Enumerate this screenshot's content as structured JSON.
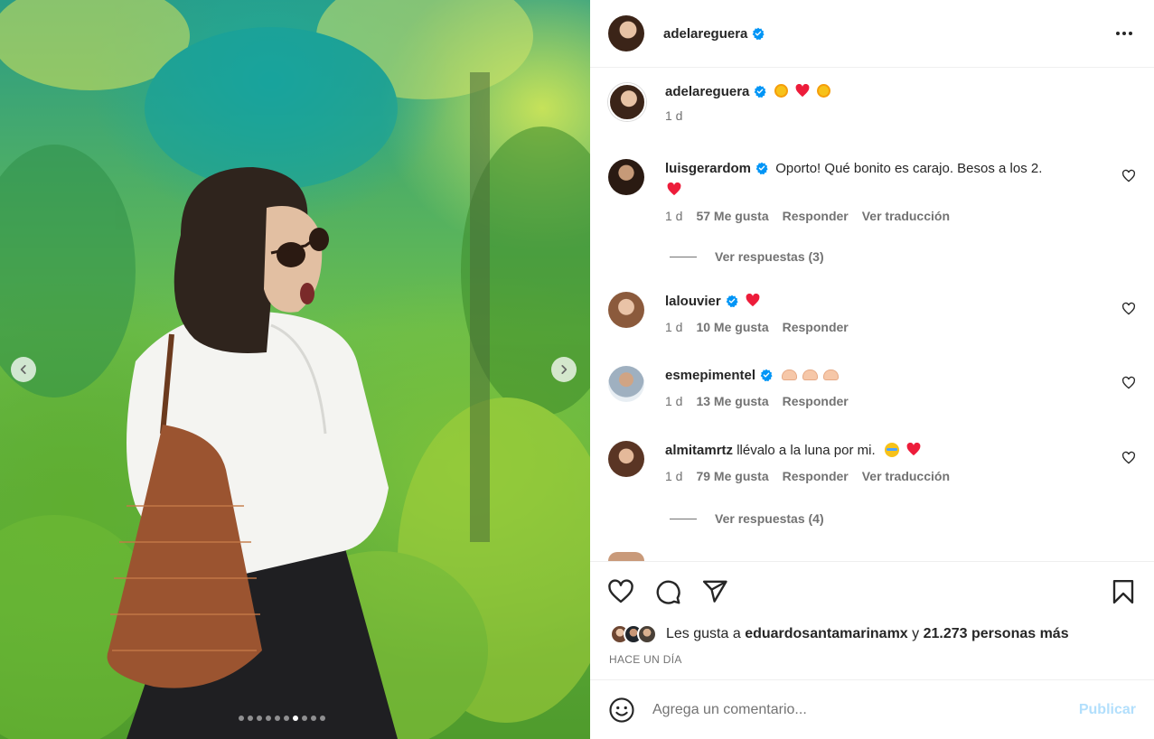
{
  "post": {
    "image_alt": "Mujer con gafas de sol, camisa blanca y bolso tejido en un bosque",
    "carousel": {
      "total": 10,
      "active": 7
    },
    "username": "adelareguera",
    "more_icon": "more-horizontal-icon"
  },
  "caption": {
    "username": "adelareguera",
    "emojis": [
      "sun",
      "red-heart",
      "sun"
    ],
    "time": "1 d"
  },
  "comments": [
    {
      "username": "luisgerardom",
      "verified": true,
      "text": "Oporto! Qué bonito es carajo. Besos a los 2.",
      "emojis": [
        "red-heart"
      ],
      "time": "1 d",
      "likes": "57 Me gusta",
      "reply": "Responder",
      "translate": "Ver traducción",
      "replies_label": "Ver respuestas (3)"
    },
    {
      "username": "lalouvier",
      "verified": true,
      "text": "",
      "emojis": [
        "red-heart"
      ],
      "time": "1 d",
      "likes": "10 Me gusta",
      "reply": "Responder"
    },
    {
      "username": "esmepimentel",
      "verified": true,
      "text": "",
      "emojis": [
        "heart-hands",
        "heart-hands",
        "heart-hands"
      ],
      "time": "1 d",
      "likes": "13 Me gusta",
      "reply": "Responder"
    },
    {
      "username": "almitamrtz",
      "verified": false,
      "text": "llévalo a la luna por mi.",
      "emojis": [
        "loudly-crying-face",
        "red-heart"
      ],
      "time": "1 d",
      "likes": "79 Me gusta",
      "reply": "Responder",
      "translate": "Ver traducción",
      "replies_label": "Ver respuestas (4)"
    }
  ],
  "likes": {
    "prefix": "Les gusta a",
    "user": "eduardosantamarinamx",
    "joiner": "y",
    "others": "21.273 personas más"
  },
  "time_ago": "HACE UN DÍA",
  "composer": {
    "placeholder": "Agrega un comentario...",
    "publish": "Publicar"
  },
  "colors": {
    "verified": "#0095f6",
    "publish_disabled": "#b2dffc",
    "secondary_text": "#737373",
    "heart": "#ed1c3a"
  }
}
